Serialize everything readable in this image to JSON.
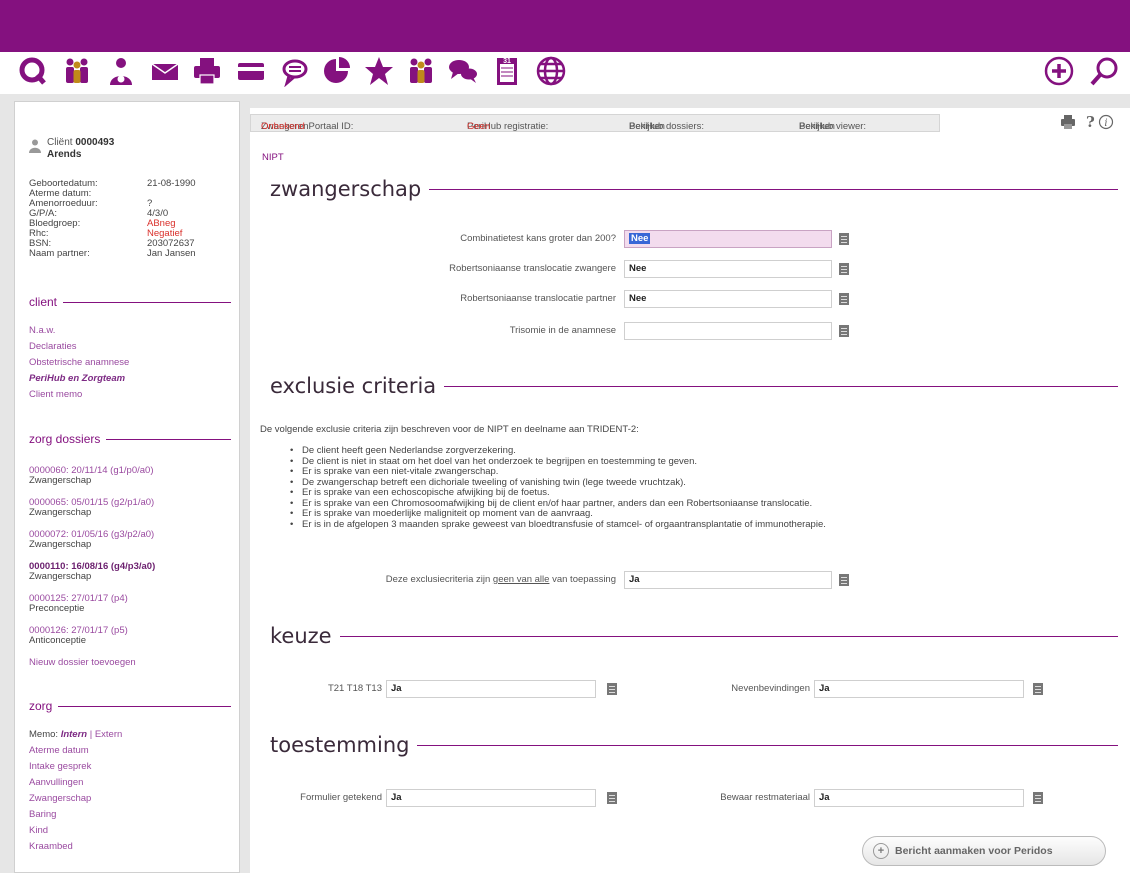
{
  "colors": {
    "brand": "#84117f",
    "link": "#9a4aa0",
    "warning": "#d9302b",
    "focus_field": "#f3dcee"
  },
  "toolbar": {
    "icons": [
      "refresh-icon",
      "team-icon",
      "client-icon",
      "mail-icon",
      "print-icon",
      "card-icon",
      "chat-icon",
      "piechart-icon",
      "star-icon",
      "team-icon",
      "conversation-icon",
      "calendar-icon",
      "globe-icon"
    ],
    "add_icon": "add-icon",
    "search_icon": "search-icon",
    "calendar_number": "31"
  },
  "sidebar": {
    "client": {
      "prefix": "Cliënt",
      "number": "0000493",
      "name": "Arends"
    },
    "info": [
      {
        "key": "Geboortedatum:",
        "value": "21-08-1990"
      },
      {
        "key": "Aterme datum:",
        "value": ""
      },
      {
        "key": "Amenorroeduur:",
        "value": "?"
      },
      {
        "key": "G/P/A:",
        "value": "4/3/0"
      },
      {
        "key": "Bloedgroep:",
        "value": "ABneg"
      },
      {
        "key": "Rhc:",
        "value": "Negatief"
      },
      {
        "key": "BSN:",
        "value": "203072637"
      },
      {
        "key": "Naam partner:",
        "value": "Jan Jansen"
      }
    ],
    "client_section": {
      "title": "client",
      "links": [
        "N.a.w.",
        "Declaraties",
        "Obstetrische anamnese",
        "PeriHub en Zorgteam",
        "Client memo"
      ]
    },
    "dossiers_section": {
      "title": "zorg dossiers",
      "items": [
        {
          "code": "0000060: 20/11/14 (g1/p0/a0)",
          "type": "Zwangerschap"
        },
        {
          "code": "0000065: 05/01/15 (g2/p1/a0)",
          "type": "Zwangerschap"
        },
        {
          "code": "0000072: 01/05/16 (g3/p2/a0)",
          "type": "Zwangerschap"
        },
        {
          "code": "0000110: 16/08/16 (g4/p3/a0)",
          "type": "Zwangerschap"
        },
        {
          "code": "0000125: 27/01/17 (p4)",
          "type": "Preconceptie"
        },
        {
          "code": "0000126: 27/01/17 (p5)",
          "type": "Anticonceptie"
        }
      ],
      "add_label": "Nieuw dossier toevoegen"
    },
    "zorg_section": {
      "title": "zorg",
      "memo_label": "Memo:",
      "memo_intern": "Intern",
      "memo_sep": " | ",
      "memo_extern": "Extern",
      "links": [
        "Aterme datum",
        "Intake gesprek",
        "Aanvullingen",
        "Zwangerschap",
        "Baring",
        "Kind",
        "Kraambed"
      ]
    }
  },
  "infobar": {
    "portaal_label": "ZwangerenPortaal ID:",
    "portaal_value": "Onbekend",
    "registratie_label": "PeriHub registratie:",
    "registratie_value": "Geen",
    "dossiers_label": "PeriHub dossiers:",
    "dossiers_value": "Bekijken",
    "viewer_label": "PeriHub viewer:",
    "viewer_value": "Bekijken"
  },
  "crumb": "NIPT",
  "sections": {
    "zwangerschap": {
      "title": "zwangerschap",
      "fields": [
        {
          "label": "Combinatietest kans groter dan 200?",
          "value": "Nee"
        },
        {
          "label": "Robertsoniaanse translocatie zwangere",
          "value": "Nee"
        },
        {
          "label": "Robertsoniaanse translocatie partner",
          "value": "Nee"
        },
        {
          "label": "Trisomie in de anamnese",
          "value": ""
        }
      ]
    },
    "exclusie": {
      "title": "exclusie criteria",
      "intro": "De volgende exclusie criteria zijn beschreven voor de NIPT en deelname aan TRIDENT-2:",
      "criteria": [
        "De client heeft geen Nederlandse zorgverzekering.",
        "De client is niet in staat om het doel van het onderzoek te begrijpen en toestemming te geven.",
        "Er is sprake van een niet-vitale zwangerschap.",
        "De zwangerschap betreft een dichoriale tweeling of vanishing twin (lege tweede vruchtzak).",
        "Er is sprake van een echoscopische afwijking bij de foetus.",
        "Er is sprake van een Chromosoomafwijking bij de client en/of haar partner, anders dan een Robertsoniaanse translocatie.",
        "Er is sprake van moederlijke maligniteit op moment van de aanvraag.",
        "Er is in de afgelopen 3 maanden sprake geweest van bloedtransfusie of stamcel- of orgaantransplantatie of immunotherapie."
      ],
      "question_pre": "Deze exclusiecriteria zijn ",
      "question_underline": "geen van alle",
      "question_post": " van toepassing",
      "answer": "Ja"
    },
    "keuze": {
      "title": "keuze",
      "t21_label": "T21 T18 T13",
      "t21_value": "Ja",
      "neven_label": "Nevenbevindingen",
      "neven_value": "Ja"
    },
    "toestemming": {
      "title": "toestemming",
      "formulier_label": "Formulier getekend",
      "formulier_value": "Ja",
      "bewaar_label": "Bewaar restmateriaal",
      "bewaar_value": "Ja"
    }
  },
  "bericht_button": "Bericht aanmaken voor Peridos"
}
